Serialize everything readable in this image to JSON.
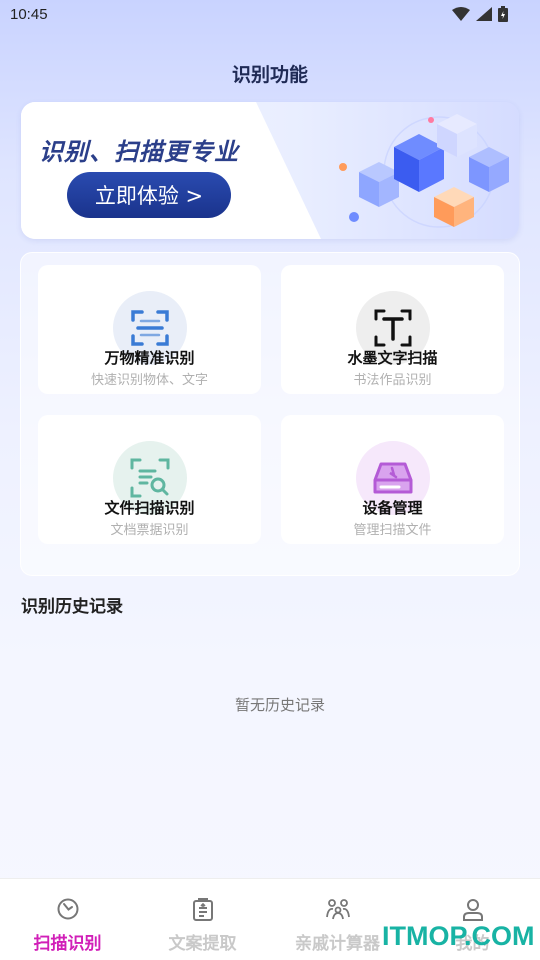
{
  "status_bar": {
    "time": "10:45",
    "icons": [
      "wifi-icon",
      "signal-icon",
      "battery-icon"
    ]
  },
  "page": {
    "title": "识别功能"
  },
  "banner": {
    "headline": "识别、扫描更专业",
    "cta_label": "立即体验 >",
    "accent_color": "#1f3a9a"
  },
  "features": [
    {
      "title": "万物精准识别",
      "subtitle": "快速识别物体、文字",
      "icon": "scan-frame-icon",
      "icon_bg": "#e9eef8",
      "icon_color": "#3a7bd5"
    },
    {
      "title": "水墨文字扫描",
      "subtitle": "书法作品识别",
      "icon": "text-scan-icon",
      "icon_bg": "#eeeeee",
      "icon_color": "#111111"
    },
    {
      "title": "文件扫描识别",
      "subtitle": "文档票据识别",
      "icon": "document-search-icon",
      "icon_bg": "#e6f2ee",
      "icon_color": "#5fb6a0"
    },
    {
      "title": "设备管理",
      "subtitle": "管理扫描文件",
      "icon": "storage-drive-icon",
      "icon_bg": "#f6e8fb",
      "icon_color": "#b45bd6"
    }
  ],
  "history": {
    "title": "识别历史记录",
    "empty_text": "暂无历史记录"
  },
  "bottom_nav": {
    "items": [
      {
        "label": "扫描识别",
        "icon": "scan-nav-icon",
        "active": true
      },
      {
        "label": "文案提取",
        "icon": "clipboard-nav-icon",
        "active": false
      },
      {
        "label": "亲戚计算器",
        "icon": "family-nav-icon",
        "active": false
      },
      {
        "label": "我的",
        "icon": "profile-nav-icon",
        "active": false
      }
    ],
    "active_color": "#d11fb8",
    "inactive_color": "#c9c9c9"
  },
  "watermark": {
    "text": "ITMOP.COM",
    "color": "#18b3a4"
  }
}
